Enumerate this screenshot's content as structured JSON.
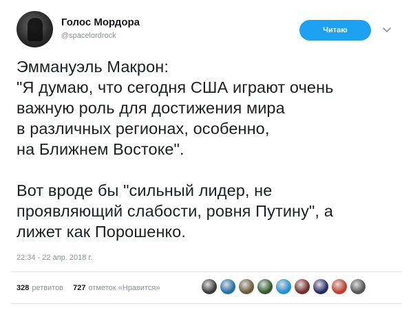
{
  "author": {
    "name": "Голос Мордора",
    "handle": "@spacelordrock"
  },
  "follow_button": {
    "label": "Читаю"
  },
  "tweet": {
    "paragraph1": [
      "Эммануэль Макрон:",
      "\"Я думаю, что сегодня США играют очень",
      "важную роль для достижения мира",
      "в различных регионах, особенно,",
      "на Ближнем Востоке\"."
    ],
    "paragraph2": [
      "Вот вроде бы \"сильный лидер, не",
      "проявляющий слабости, ровня Путину\", а",
      "лижет как Порошенко."
    ],
    "timestamp": "22:34 - 22 апр. 2018 г."
  },
  "stats": {
    "retweets_count": "328",
    "retweets_label": "ретвитов",
    "likes_count": "727",
    "likes_label": "отметок «Нравится»"
  },
  "likers": [
    {
      "icon": "avatar",
      "color": "#3a3a3a"
    },
    {
      "icon": "avatar",
      "color": "#1f6fa8"
    },
    {
      "icon": "avatar",
      "color": "#6b5a3a"
    },
    {
      "icon": "avatar",
      "color": "#2f5a2a"
    },
    {
      "icon": "avatar",
      "color": "#1d8fd8"
    },
    {
      "icon": "avatar",
      "color": "#7a2a2a"
    },
    {
      "icon": "avatar",
      "color": "#2a2a6a"
    },
    {
      "icon": "avatar",
      "color": "#c53a2a"
    },
    {
      "icon": "avatar",
      "color": "#555555"
    }
  ],
  "colors": {
    "accent": "#1da1f2",
    "muted": "#8a9099",
    "text": "#1c2022",
    "divider": "#e1e8ed"
  }
}
